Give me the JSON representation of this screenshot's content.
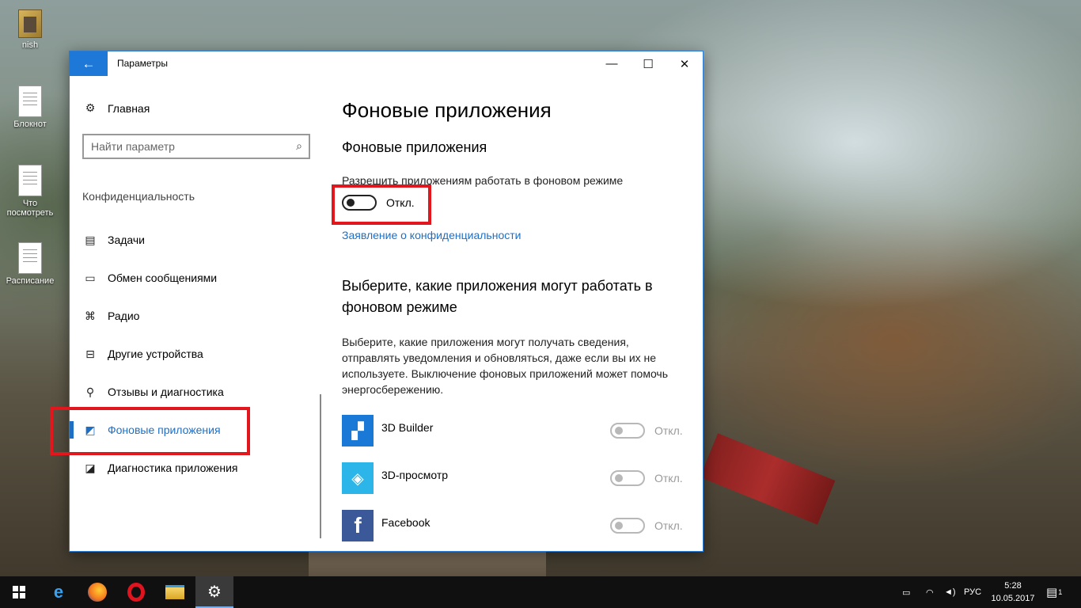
{
  "desktop": {
    "icons": [
      {
        "label": "nish"
      },
      {
        "label": "Блокнот"
      },
      {
        "label": "Что посмотреть"
      },
      {
        "label": "Расписание"
      }
    ]
  },
  "window": {
    "title": "Параметры",
    "back_glyph": "←",
    "minimize_glyph": "—",
    "maximize_glyph": "☐",
    "close_glyph": "✕"
  },
  "sidebar": {
    "home_label": "Главная",
    "search_placeholder": "Найти параметр",
    "section_label": "Конфиденциальность",
    "items": [
      {
        "label": "Задачи",
        "icon": "tasks-icon"
      },
      {
        "label": "Обмен сообщениями",
        "icon": "message-icon"
      },
      {
        "label": "Радио",
        "icon": "radio-icon"
      },
      {
        "label": "Другие устройства",
        "icon": "devices-icon"
      },
      {
        "label": "Отзывы и диагностика",
        "icon": "feedback-icon"
      },
      {
        "label": "Фоновые приложения",
        "icon": "background-apps-icon",
        "active": true
      },
      {
        "label": "Диагностика приложения",
        "icon": "app-diagnostics-icon"
      }
    ]
  },
  "content": {
    "page_title": "Фоновые приложения",
    "section_title": "Фоновые приложения",
    "allow_label": "Разрешить приложениям работать в фоновом режиме",
    "allow_state": "Откл.",
    "privacy_link": "Заявление о конфиденциальности",
    "choose_title": "Выберите, какие приложения могут работать в фоновом режиме",
    "choose_desc": "Выберите, какие приложения могут получать сведения, отправлять уведомления и обновляться, даже если вы их не используете. Выключение фоновых приложений может помочь энергосбережению.",
    "apps": [
      {
        "name": "3D Builder",
        "state": "Откл.",
        "color": "#1a78d6"
      },
      {
        "name": "3D-просмотр",
        "state": "Откл.",
        "color": "#2cb5e8"
      },
      {
        "name": "Facebook",
        "state": "Откл.",
        "color": "#3b5998"
      }
    ]
  },
  "taskbar": {
    "language": "РУС",
    "time": "5:28",
    "date": "10.05.2017",
    "notification_count": "1"
  },
  "colors": {
    "accent": "#1e78d7",
    "highlight_box": "#e2171e"
  }
}
